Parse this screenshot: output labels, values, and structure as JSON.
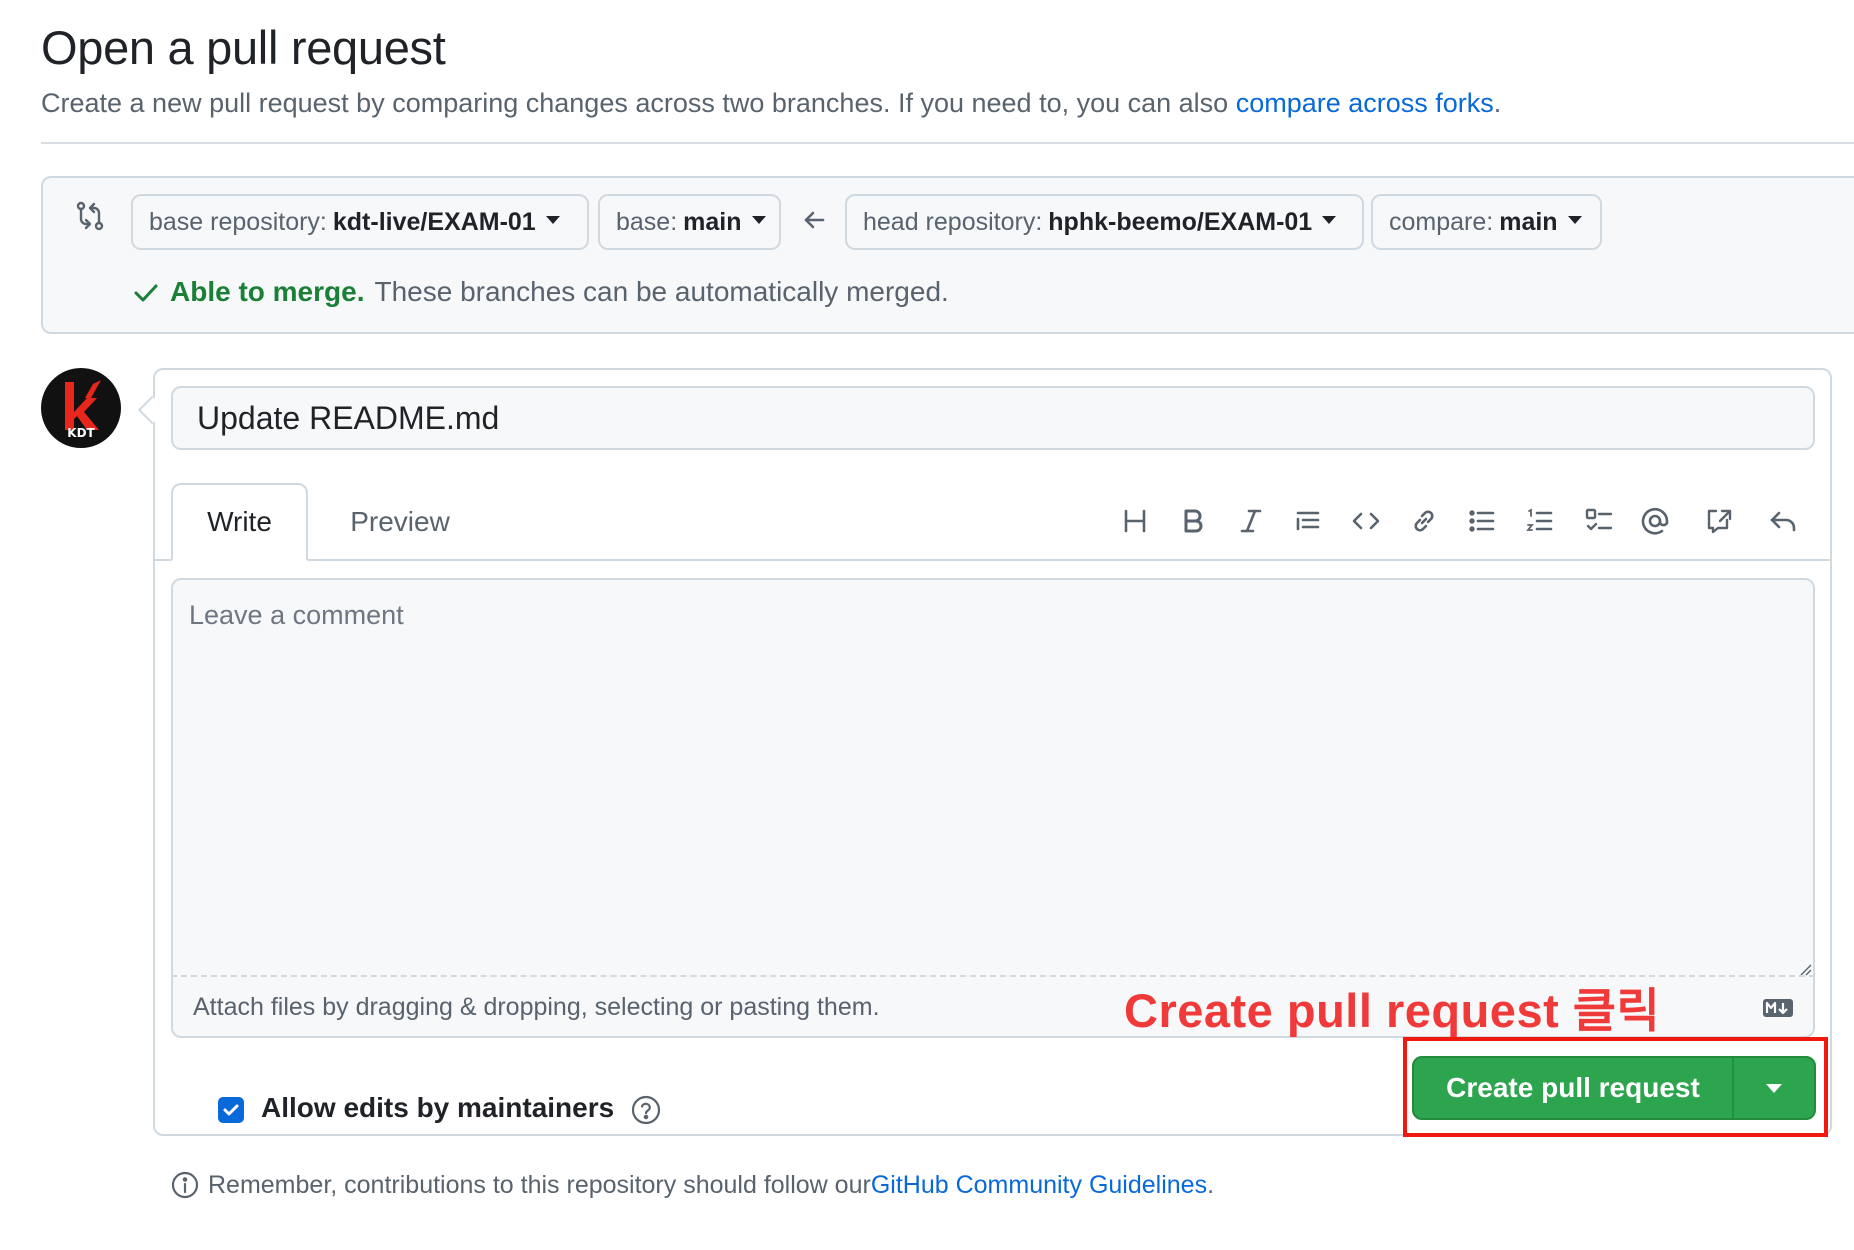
{
  "header": {
    "title": "Open a pull request",
    "subtitle_text": "Create a new pull request by comparing changes across two branches. If you need to, you can also ",
    "subtitle_link": "compare across forks",
    "subtitle_end": "."
  },
  "compare": {
    "base_repo_label": "base repository:",
    "base_repo_value": "kdt-live/EXAM-01",
    "base_label": "base:",
    "base_value": "main",
    "head_repo_label": "head repository:",
    "head_repo_value": "hphk-beemo/EXAM-01",
    "compare_label": "compare:",
    "compare_value": "main",
    "merge_status_bold": "Able to merge.",
    "merge_status_text": "These branches can be automatically merged."
  },
  "avatar": {
    "text": "KDT"
  },
  "form": {
    "title_value": "Update README.md",
    "tab_write": "Write",
    "tab_preview": "Preview",
    "comment_placeholder": "Leave a comment",
    "attach_text": "Attach files by dragging & dropping, selecting or pasting them.",
    "allow_edits_label": "Allow edits by maintainers",
    "allow_edits_checked": true,
    "create_button_label": "Create pull request"
  },
  "toolbar": {
    "icons": [
      "heading-icon",
      "bold-icon",
      "italic-icon",
      "quote-icon",
      "code-icon",
      "link-icon",
      "unordered-list-icon",
      "ordered-list-icon",
      "task-list-icon",
      "mention-icon",
      "reference-icon",
      "reply-icon"
    ]
  },
  "annotation": {
    "text": "Create pull request 클릭"
  },
  "footer": {
    "text": "Remember, contributions to this repository should follow our ",
    "link": "GitHub Community Guidelines",
    "end": "."
  },
  "colors": {
    "accent_blue": "#0969da",
    "success_green": "#1a7f37",
    "button_green": "#2da44e",
    "annotation_red": "#f03a3a"
  }
}
